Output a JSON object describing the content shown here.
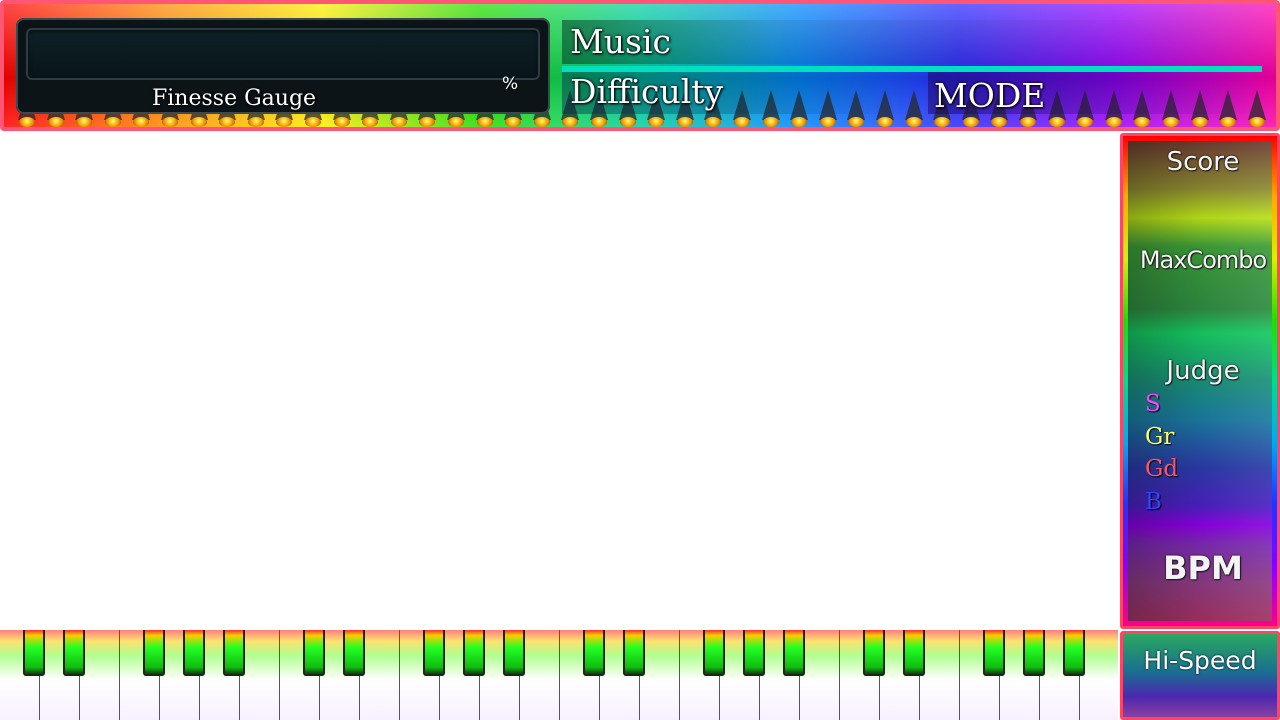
{
  "header": {
    "gauge": {
      "label": "Finesse Gauge",
      "percent_symbol": "%"
    },
    "music_label": "Music",
    "difficulty_label": "Difficulty",
    "mode_label": "MODE"
  },
  "sidebar": {
    "score_label": "Score",
    "maxcombo_label": "MaxCombo",
    "judge_label": "Judge",
    "judges": [
      {
        "label": "S",
        "color": "#ff44ff"
      },
      {
        "label": "Gr",
        "color": "#ffff66"
      },
      {
        "label": "Gd",
        "color": "#ff5566"
      },
      {
        "label": "B",
        "color": "#3344ff"
      }
    ],
    "bpm_label": "BPM",
    "hispeed_label": "Hi-Speed"
  },
  "theme": {
    "frame_border": "#ff4466",
    "divider": "#00e0c0",
    "background": "#ffffff"
  }
}
